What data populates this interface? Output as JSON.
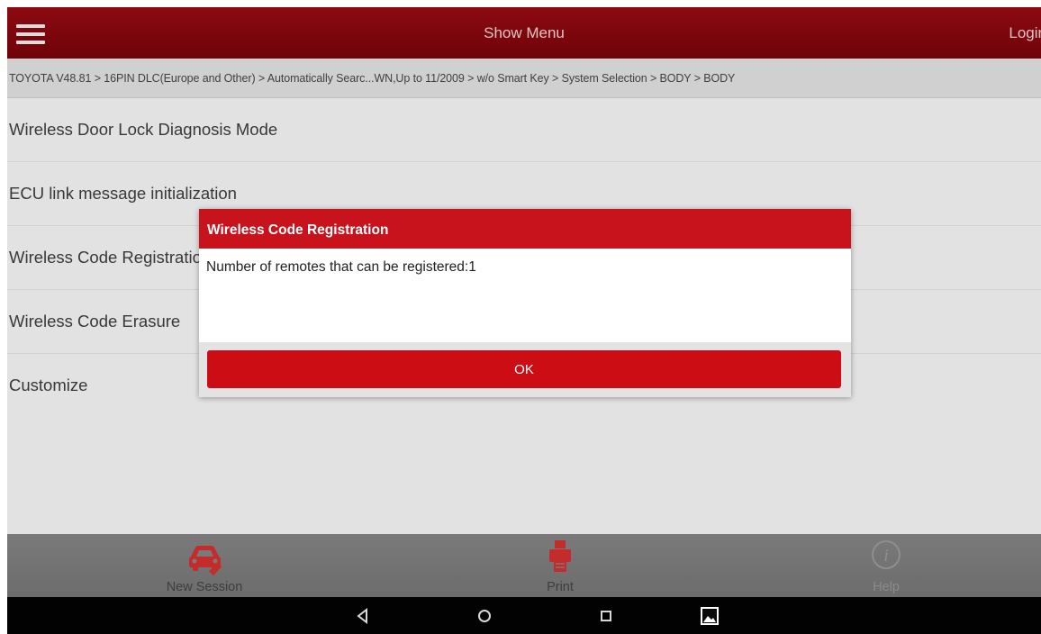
{
  "topbar": {
    "title": "Show Menu",
    "login_label": "Login"
  },
  "breadcrumb": "TOYOTA V48.81 > 16PIN DLC(Europe and Other) > Automatically Searc...WN,Up to 11/2009 > w/o Smart Key > System Selection > BODY > BODY",
  "menu_items": [
    "Wireless Door Lock Diagnosis Mode",
    "ECU link message initialization",
    "Wireless Code Registration",
    "Wireless Code Erasure",
    "Customize"
  ],
  "dialog": {
    "title": "Wireless Code Registration",
    "message": "Number of remotes that can be registered:1",
    "ok_label": "OK"
  },
  "toolbar": [
    {
      "label": "New Session",
      "icon": "car-check-icon"
    },
    {
      "label": "Print",
      "icon": "printer-icon"
    },
    {
      "label": "Help",
      "icon": "info-icon"
    }
  ],
  "navbar": [
    "back-icon",
    "home-icon",
    "recents-icon",
    "screenshot-icon"
  ],
  "colors": {
    "topbar": "#7c050c",
    "dialog_header": "#c8131d",
    "ok_button": "#cc0d14",
    "toolbar_icon_red": "#c42c2c"
  }
}
